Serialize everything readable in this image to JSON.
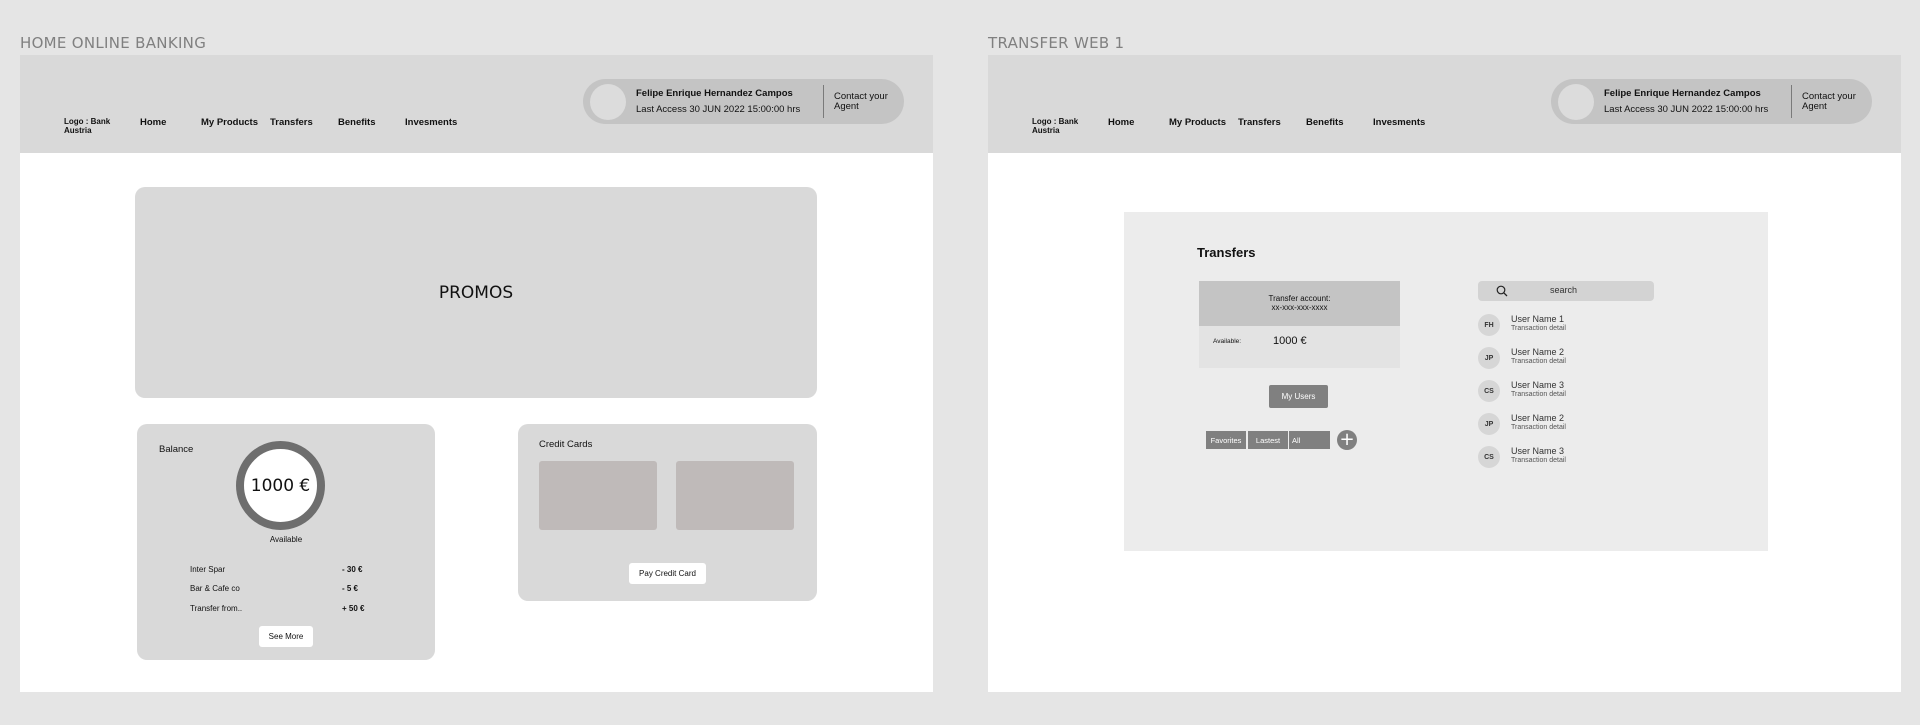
{
  "frames": {
    "home_title": "HOME ONLINE BANKING",
    "transfer_title": "TRANSFER WEB 1"
  },
  "header": {
    "logo": "Logo : Bank Austria",
    "nav": [
      "Home",
      "My Products",
      "Transfers",
      "Benefits",
      "Invesments"
    ],
    "user_name": "Felipe Enrique Hernandez Campos",
    "last_access": "Last Access 30 JUN 2022  15:00:00 hrs",
    "contact": "Contact your Agent"
  },
  "home": {
    "promos": "PROMOS",
    "balance": {
      "title": "Balance",
      "amount": "1000 €",
      "available": "Available",
      "transactions": [
        {
          "name": "Inter Spar",
          "amount": "- 30 €"
        },
        {
          "name": "Bar & Cafe co",
          "amount": "- 5 €"
        },
        {
          "name": "Transfer from..",
          "amount": "+ 50 €"
        }
      ],
      "see_more": "See More"
    },
    "credit_cards": {
      "title": "Credit Cards",
      "pay_button": "Pay Credit Card"
    }
  },
  "transfer": {
    "title": "Transfers",
    "account_label": "Transfer account:",
    "account_number": "xx-xxx-xxx-xxxx",
    "available_label": "Available:",
    "available_amount": "1000 €",
    "my_users": "My Users",
    "filters": [
      "Favorites",
      "Lastest",
      "All"
    ],
    "add_symbol": "+",
    "search_placeholder": "search",
    "users": [
      {
        "initials": "FH",
        "name": "User Name 1",
        "detail": "Transaction detail"
      },
      {
        "initials": "JP",
        "name": "User Name 2",
        "detail": "Transaction detail"
      },
      {
        "initials": "CS",
        "name": "User Name 3",
        "detail": "Transaction detail"
      },
      {
        "initials": "JP",
        "name": "User Name 2",
        "detail": "Transaction detail"
      },
      {
        "initials": "CS",
        "name": "User Name 3",
        "detail": "Transaction detail"
      }
    ]
  }
}
